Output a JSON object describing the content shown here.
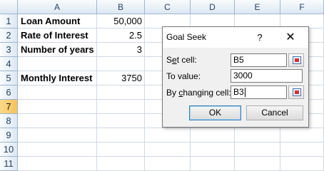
{
  "sheet": {
    "columns": [
      "A",
      "B",
      "C",
      "D",
      "E",
      "F"
    ],
    "rows": [
      "1",
      "2",
      "3",
      "4",
      "5",
      "6",
      "7",
      "8",
      "9",
      "10",
      "11"
    ],
    "active_row": "7",
    "cells": {
      "A1": "Loan Amount",
      "B1": "50,000",
      "A2": "Rate of Interest",
      "B2": "2.5",
      "A3": "Number of years",
      "B3": "3",
      "A5": "Monthly Interest",
      "B5": "3750"
    }
  },
  "dialog": {
    "title": "Goal Seek",
    "help_label": "?",
    "close_label": "✕",
    "set_cell_label_prefix": "S",
    "set_cell_label_underlined": "e",
    "set_cell_label_rest": "t cell:",
    "set_cell_value": "B5",
    "to_value_label": "To value:",
    "to_value_value": "3000",
    "by_changing_label_prefix": "By ",
    "by_changing_label_underlined": "c",
    "by_changing_label_rest": "hanging cell:",
    "by_changing_value": "B3",
    "ok_label": "OK",
    "cancel_label": "Cancel",
    "ref_button_icon": "range-select-icon"
  },
  "colors": {
    "header_bg": "#dde7f3",
    "active_row_header": "#f7c25a",
    "gridline": "#d0d7e5",
    "dialog_bg": "#f0f0f0"
  }
}
